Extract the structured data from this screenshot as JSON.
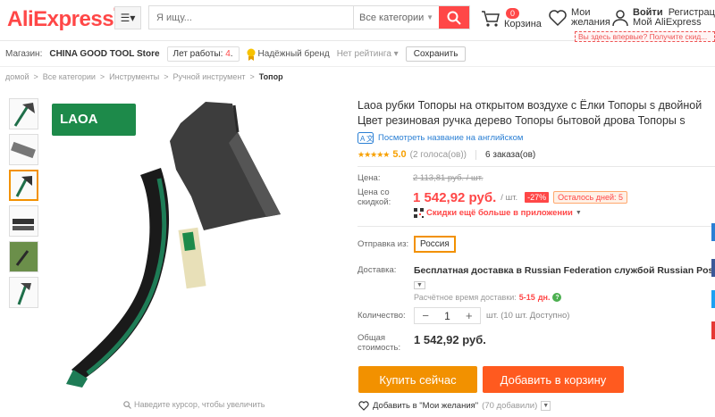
{
  "header": {
    "logo": "AliExpress",
    "search_placeholder": "Я ищу...",
    "search_category": "Все категории",
    "cart_count": "0",
    "cart_label": "Корзина",
    "wish_line1": "Мои",
    "wish_line2": "желания",
    "login_label": "Войти",
    "register_label": "Регистрация",
    "account_label": "Мой AliExpress",
    "promo_text": "Вы здесь впервые? Получите скид..."
  },
  "store": {
    "shop_label": "Магазин:",
    "shop_name": "CHINA GOOD TOOL Store",
    "years_label": "Лет работы:",
    "years_value": "4",
    "brand_label": "Надёжный бренд",
    "rating_label": "Нет рейтинга",
    "save_label": "Сохранить"
  },
  "breadcrumb": [
    "домой",
    "Все категории",
    "Инструменты",
    "Ручной инструмент",
    "Топор"
  ],
  "gallery": {
    "zoom_hint": "Наведите курсор, чтобы увеличить",
    "brand_logo": "LAOA"
  },
  "product": {
    "title": "Laoa рубки Топоры на открытом воздухе с Ёлки Топоры s двойной Цвет резиновая ручка дерево Топоры бытовой дрова Топоры s",
    "translate_label": "Посмотреть название на английском",
    "rating_value": "5.0",
    "votes": "(2 голоса(ов))",
    "orders": "6 заказа(ов)",
    "price_label": "Цена:",
    "old_price": "2 113,81 руб. / шт.",
    "discount_label_1": "Цена со",
    "discount_label_2": "скидкой:",
    "new_price": "1 542,92 руб.",
    "unit": "/ шт.",
    "discount": "-27%",
    "days_left": "Осталось дней: 5",
    "app_deal": "Скидки ещё больше в приложении",
    "ship_from_label": "Отправка из:",
    "ship_from_value": "Россия",
    "delivery_label": "Доставка:",
    "delivery_value": "Бесплатная доставка в Russian Federation службой Russian Post",
    "delivery_time_label": "Расчётное время доставки:",
    "delivery_time_value": "5-15",
    "delivery_time_unit": "дн.",
    "qty_label": "Количество:",
    "qty_value": "1",
    "qty_available": "шт. (10 шт. Доступно)",
    "total_label_1": "Общая",
    "total_label_2": "стоимость:",
    "total_value": "1 542,92 руб.",
    "buy_now": "Купить сейчас",
    "add_to_cart": "Добавить в корзину",
    "wishlist_label": "Добавить в \"Мои желания\"",
    "wishlist_count": "(70 добавили)"
  },
  "colors": {
    "accent": "#ff4747",
    "orange": "#f29100",
    "cart_button": "#ff5a1f",
    "link": "#2a7fd4"
  }
}
